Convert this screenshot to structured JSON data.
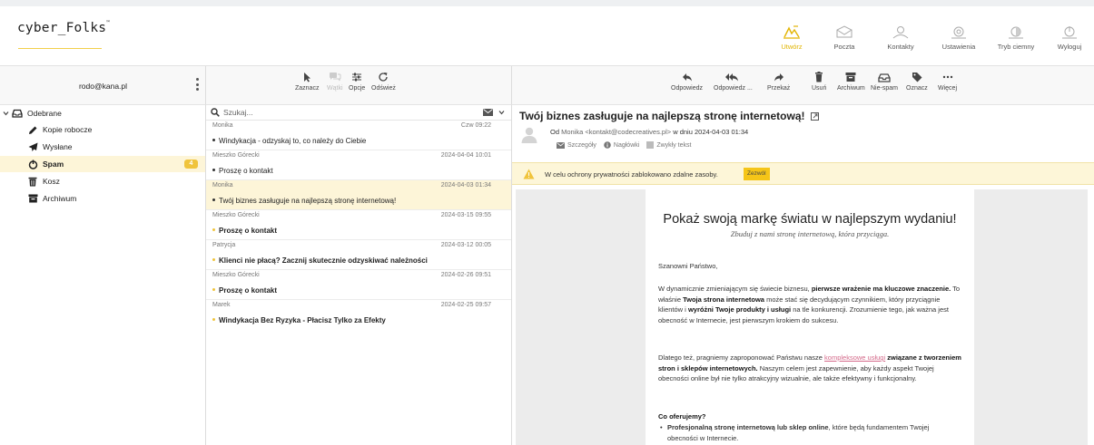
{
  "brand": {
    "logo_text": "cyber_Folks",
    "logo_mark": "™"
  },
  "header_nav": [
    {
      "label": "Utwórz",
      "icon": "compose-icon",
      "active": true
    },
    {
      "label": "Poczta",
      "icon": "mail-icon"
    },
    {
      "label": "Kontakty",
      "icon": "contacts-icon"
    },
    {
      "label": "Ustawienia",
      "icon": "settings-icon"
    },
    {
      "label": "Tryb ciemny",
      "icon": "dark-mode-icon"
    },
    {
      "label": "Wyloguj",
      "icon": "logout-icon"
    }
  ],
  "account": {
    "email": "rodo@kana.pl"
  },
  "list_toolbar": [
    {
      "label": "Zaznacz",
      "icon": "cursor-icon"
    },
    {
      "label": "Wątki",
      "icon": "threads-icon",
      "disabled": true
    },
    {
      "label": "Opcje",
      "icon": "options-icon"
    },
    {
      "label": "Odśwież",
      "icon": "refresh-icon"
    }
  ],
  "message_toolbar": [
    {
      "label": "Odpowiedz",
      "icon": "reply-icon"
    },
    {
      "label": "Odpowiedz ...",
      "icon": "reply-all-icon"
    },
    {
      "label": "Przekaż",
      "icon": "forward-icon"
    },
    {
      "label": "Usuń",
      "icon": "trash-icon"
    },
    {
      "label": "Archiwum",
      "icon": "archive-icon"
    },
    {
      "label": "Nie-spam",
      "icon": "not-spam-icon"
    },
    {
      "label": "Oznacz",
      "icon": "tag-icon"
    },
    {
      "label": "Więcej",
      "icon": "more-icon"
    }
  ],
  "folders": [
    {
      "label": "Odebrane",
      "icon": "inbox-icon"
    },
    {
      "label": "Kopie robocze",
      "icon": "pencil-icon"
    },
    {
      "label": "Wysłane",
      "icon": "send-icon"
    },
    {
      "label": "Spam",
      "icon": "spam-icon",
      "active": true,
      "badge": "4"
    },
    {
      "label": "Kosz",
      "icon": "trash-icon"
    },
    {
      "label": "Archiwum",
      "icon": "archive-icon"
    }
  ],
  "search": {
    "placeholder": "Szukaj..."
  },
  "messages": [
    {
      "from": "Monika",
      "date": "Czw 09:22",
      "subject": "Windykacja - odzyskaj to, co należy do Ciebie",
      "unread": false
    },
    {
      "from": "Mieszko Górecki",
      "date": "2024-04-04 10:01",
      "subject": "Proszę o kontakt",
      "unread": false
    },
    {
      "from": "Monika",
      "date": "2024-04-03 01:34",
      "subject": "Twój biznes zasługuje na najlepszą stronę internetową!",
      "unread": false,
      "selected": true
    },
    {
      "from": "Mieszko Górecki",
      "date": "2024-03-15 09:55",
      "subject": "Proszę o kontakt",
      "unread": true
    },
    {
      "from": "Patrycja",
      "date": "2024-03-12 00:05",
      "subject": "Klienci nie płacą? Zacznij skutecznie odzyskiwać należności",
      "unread": true
    },
    {
      "from": "Mieszko Górecki",
      "date": "2024-02-26 09:51",
      "subject": "Proszę o kontakt",
      "unread": true
    },
    {
      "from": "Marek",
      "date": "2024-02-25 09:57",
      "subject": "Windykacja Bez Ryzyka - Płacisz Tylko za Efekty",
      "unread": true
    }
  ],
  "email": {
    "subject": "Twój biznes zasługuje na najlepszą stronę internetową!",
    "from_prefix": "Od",
    "from_name": "Monika <kontakt@codecreatives.pl>",
    "date_prefix": "w dniu",
    "date": "2024-04-03 01:34",
    "meta_details": "Szczegóły",
    "meta_headers": "Nagłówki",
    "meta_plain": "Zwykły tekst",
    "privacy_notice": "W celu ochrony prywatności zablokowano zdalne zasoby.",
    "allow_button": "Zezwól",
    "body": {
      "headline": "Pokaż swoją markę światu w najlepszym wydaniu!",
      "tagline": "Zbuduj z nami stronę internetową, która przyciąga.",
      "greeting": "Szanowni Państwo,",
      "p1_a": "W dynamicznie zmieniającym się świecie biznesu, ",
      "p1_b": "pierwsze wrażenie ma kluczowe znaczenie.",
      "p1_c": " To właśnie ",
      "p1_d": "Twoja strona internetowa",
      "p1_e": " może stać się decydującym czynnikiem, który przyciągnie klientów i ",
      "p1_f": "wyróżni Twoje produkty i usługi",
      "p1_g": " na tle konkurencji. Zrozumienie tego, jak ważna jest obecność w Internecie, jest pierwszym krokiem do sukcesu.",
      "p2_a": "Dlatego też, pragniemy zaproponować Państwu nasze ",
      "p2_link": "kompleksowe usługi",
      "p2_b": " związane z tworzeniem stron i sklepów internetowych.",
      "p2_c": " Naszym celem jest zapewnienie, aby każdy aspekt Twojej obecności online był nie tylko atrakcyjny wizualnie, ale także efektywny i funkcjonalny.",
      "offer_heading": "Co oferujemy?",
      "li1_a": "Profesjonalną stronę internetową lub sklep online",
      "li1_b": ", które będą fundamentem Twojej obecności w Internecie."
    }
  },
  "colors": {
    "accent": "#f5c518",
    "selected_bg": "#fdf5d8",
    "unread_dot": "#f0c43c",
    "link": "#d46a8a"
  }
}
